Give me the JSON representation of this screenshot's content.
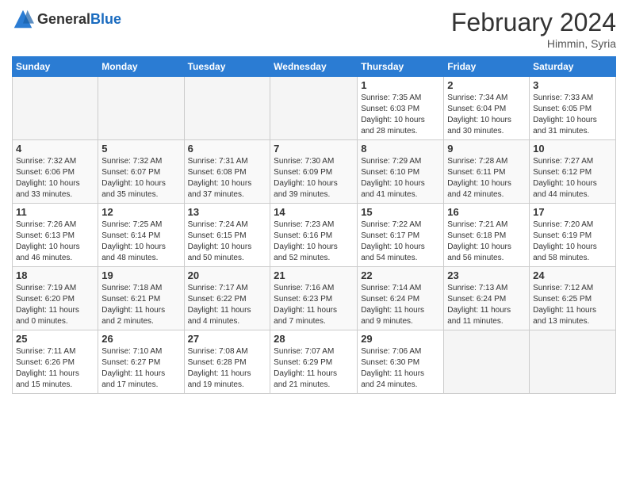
{
  "header": {
    "logo_general": "General",
    "logo_blue": "Blue",
    "month_title": "February 2024",
    "location": "Himmin, Syria"
  },
  "days_of_week": [
    "Sunday",
    "Monday",
    "Tuesday",
    "Wednesday",
    "Thursday",
    "Friday",
    "Saturday"
  ],
  "weeks": [
    [
      {
        "day": "",
        "info": ""
      },
      {
        "day": "",
        "info": ""
      },
      {
        "day": "",
        "info": ""
      },
      {
        "day": "",
        "info": ""
      },
      {
        "day": "1",
        "info": "Sunrise: 7:35 AM\nSunset: 6:03 PM\nDaylight: 10 hours\nand 28 minutes."
      },
      {
        "day": "2",
        "info": "Sunrise: 7:34 AM\nSunset: 6:04 PM\nDaylight: 10 hours\nand 30 minutes."
      },
      {
        "day": "3",
        "info": "Sunrise: 7:33 AM\nSunset: 6:05 PM\nDaylight: 10 hours\nand 31 minutes."
      }
    ],
    [
      {
        "day": "4",
        "info": "Sunrise: 7:32 AM\nSunset: 6:06 PM\nDaylight: 10 hours\nand 33 minutes."
      },
      {
        "day": "5",
        "info": "Sunrise: 7:32 AM\nSunset: 6:07 PM\nDaylight: 10 hours\nand 35 minutes."
      },
      {
        "day": "6",
        "info": "Sunrise: 7:31 AM\nSunset: 6:08 PM\nDaylight: 10 hours\nand 37 minutes."
      },
      {
        "day": "7",
        "info": "Sunrise: 7:30 AM\nSunset: 6:09 PM\nDaylight: 10 hours\nand 39 minutes."
      },
      {
        "day": "8",
        "info": "Sunrise: 7:29 AM\nSunset: 6:10 PM\nDaylight: 10 hours\nand 41 minutes."
      },
      {
        "day": "9",
        "info": "Sunrise: 7:28 AM\nSunset: 6:11 PM\nDaylight: 10 hours\nand 42 minutes."
      },
      {
        "day": "10",
        "info": "Sunrise: 7:27 AM\nSunset: 6:12 PM\nDaylight: 10 hours\nand 44 minutes."
      }
    ],
    [
      {
        "day": "11",
        "info": "Sunrise: 7:26 AM\nSunset: 6:13 PM\nDaylight: 10 hours\nand 46 minutes."
      },
      {
        "day": "12",
        "info": "Sunrise: 7:25 AM\nSunset: 6:14 PM\nDaylight: 10 hours\nand 48 minutes."
      },
      {
        "day": "13",
        "info": "Sunrise: 7:24 AM\nSunset: 6:15 PM\nDaylight: 10 hours\nand 50 minutes."
      },
      {
        "day": "14",
        "info": "Sunrise: 7:23 AM\nSunset: 6:16 PM\nDaylight: 10 hours\nand 52 minutes."
      },
      {
        "day": "15",
        "info": "Sunrise: 7:22 AM\nSunset: 6:17 PM\nDaylight: 10 hours\nand 54 minutes."
      },
      {
        "day": "16",
        "info": "Sunrise: 7:21 AM\nSunset: 6:18 PM\nDaylight: 10 hours\nand 56 minutes."
      },
      {
        "day": "17",
        "info": "Sunrise: 7:20 AM\nSunset: 6:19 PM\nDaylight: 10 hours\nand 58 minutes."
      }
    ],
    [
      {
        "day": "18",
        "info": "Sunrise: 7:19 AM\nSunset: 6:20 PM\nDaylight: 11 hours\nand 0 minutes."
      },
      {
        "day": "19",
        "info": "Sunrise: 7:18 AM\nSunset: 6:21 PM\nDaylight: 11 hours\nand 2 minutes."
      },
      {
        "day": "20",
        "info": "Sunrise: 7:17 AM\nSunset: 6:22 PM\nDaylight: 11 hours\nand 4 minutes."
      },
      {
        "day": "21",
        "info": "Sunrise: 7:16 AM\nSunset: 6:23 PM\nDaylight: 11 hours\nand 7 minutes."
      },
      {
        "day": "22",
        "info": "Sunrise: 7:14 AM\nSunset: 6:24 PM\nDaylight: 11 hours\nand 9 minutes."
      },
      {
        "day": "23",
        "info": "Sunrise: 7:13 AM\nSunset: 6:24 PM\nDaylight: 11 hours\nand 11 minutes."
      },
      {
        "day": "24",
        "info": "Sunrise: 7:12 AM\nSunset: 6:25 PM\nDaylight: 11 hours\nand 13 minutes."
      }
    ],
    [
      {
        "day": "25",
        "info": "Sunrise: 7:11 AM\nSunset: 6:26 PM\nDaylight: 11 hours\nand 15 minutes."
      },
      {
        "day": "26",
        "info": "Sunrise: 7:10 AM\nSunset: 6:27 PM\nDaylight: 11 hours\nand 17 minutes."
      },
      {
        "day": "27",
        "info": "Sunrise: 7:08 AM\nSunset: 6:28 PM\nDaylight: 11 hours\nand 19 minutes."
      },
      {
        "day": "28",
        "info": "Sunrise: 7:07 AM\nSunset: 6:29 PM\nDaylight: 11 hours\nand 21 minutes."
      },
      {
        "day": "29",
        "info": "Sunrise: 7:06 AM\nSunset: 6:30 PM\nDaylight: 11 hours\nand 24 minutes."
      },
      {
        "day": "",
        "info": ""
      },
      {
        "day": "",
        "info": ""
      }
    ]
  ]
}
